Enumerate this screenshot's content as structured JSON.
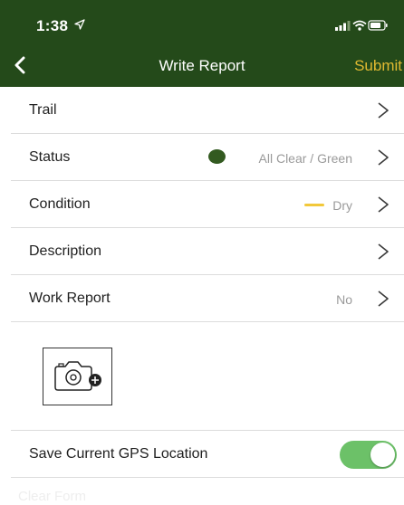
{
  "status_bar": {
    "time": "1:38"
  },
  "nav": {
    "title": "Write Report",
    "submit_label": "Submit"
  },
  "rows": [
    {
      "label": "Trail",
      "value": ""
    },
    {
      "label": "Status",
      "value": "All Clear / Green"
    },
    {
      "label": "Condition",
      "value": "Dry"
    },
    {
      "label": "Description",
      "value": ""
    },
    {
      "label": "Work Report",
      "value": "No"
    }
  ],
  "gps": {
    "label": "Save Current GPS Location",
    "enabled": true
  },
  "clear_form_label": "Clear Form",
  "colors": {
    "header_bg": "#244a1a",
    "submit": "#e0b931",
    "status_green": "#335a20",
    "condition_dry": "#f2c83a",
    "toggle_on": "#6cc168"
  },
  "icons": [
    "location-arrow-icon",
    "signal-icon",
    "wifi-icon",
    "battery-icon",
    "back-chevron-icon",
    "chevron-right-icon",
    "camera-add-icon"
  ]
}
